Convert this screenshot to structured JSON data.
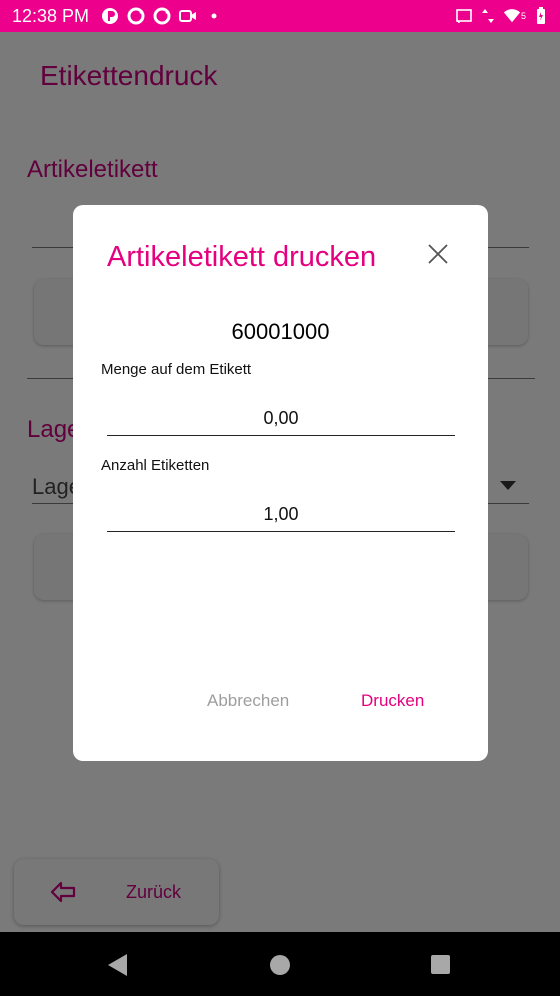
{
  "status_bar": {
    "time": "12:38 PM",
    "battery_level": "5"
  },
  "app": {
    "title": "Etikettendruck",
    "section_article": "Artikeletikett",
    "section_storage": "Lage",
    "storage_select_value": "Lage",
    "back_button_label": "Zurück"
  },
  "dialog": {
    "title": "Artikeletikett drucken",
    "article_number": "60001000",
    "quantity_label": "Menge auf dem Etikett",
    "quantity_value": "0,00",
    "label_count_label": "Anzahl Etiketten",
    "label_count_value": "1,00",
    "cancel_label": "Abbrechen",
    "print_label": "Drucken"
  },
  "colors": {
    "status_bar": "#ec008c",
    "accent": "#e4007f",
    "cancel_text": "#9e9e9e"
  }
}
